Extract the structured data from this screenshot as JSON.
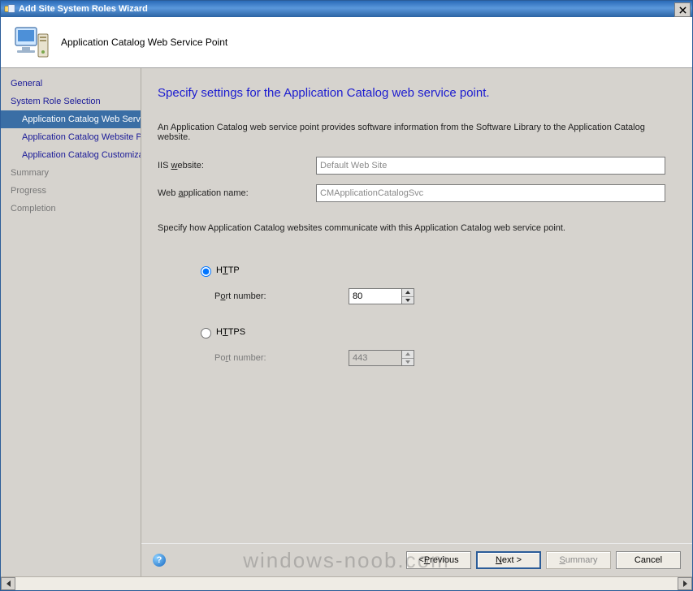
{
  "window": {
    "title": "Add Site System Roles Wizard",
    "close_tooltip": "Close"
  },
  "banner": {
    "title": "Application Catalog Web Service Point"
  },
  "sidebar": {
    "items": [
      {
        "label": "General",
        "indent": false,
        "selected": false,
        "disabled": false
      },
      {
        "label": "System Role Selection",
        "indent": false,
        "selected": false,
        "disabled": false
      },
      {
        "label": "Application Catalog Web Service Point",
        "indent": true,
        "selected": true,
        "disabled": false
      },
      {
        "label": "Application Catalog Website Point",
        "indent": true,
        "selected": false,
        "disabled": false
      },
      {
        "label": "Application Catalog Customizations",
        "indent": true,
        "selected": false,
        "disabled": false
      },
      {
        "label": "Summary",
        "indent": false,
        "selected": false,
        "disabled": true
      },
      {
        "label": "Progress",
        "indent": false,
        "selected": false,
        "disabled": true
      },
      {
        "label": "Completion",
        "indent": false,
        "selected": false,
        "disabled": true
      }
    ]
  },
  "main": {
    "heading": "Specify settings for the Application Catalog web service point.",
    "description": "An Application Catalog web service point provides software information from the Software Library to the Application Catalog website.",
    "iis_label_pre": "IIS ",
    "iis_label_u": "w",
    "iis_label_post": "ebsite:",
    "iis_value": "Default Web Site",
    "webapp_label_pre": "Web ",
    "webapp_label_u": "a",
    "webapp_label_post": "pplication name:",
    "webapp_value": "CMApplicationCatalogSvc",
    "communicate_note": "Specify how Application Catalog websites communicate with this Application Catalog web service point.",
    "http": {
      "label_pre": "H",
      "label_u": "T",
      "label_post": "TP",
      "port_label_pre": "P",
      "port_label_u": "o",
      "port_label_post": "rt number:",
      "port_value": "80",
      "selected": true
    },
    "https": {
      "label_pre": "H",
      "label_u": "T",
      "label_post": "TPS",
      "port_label_pre": "Po",
      "port_label_u": "r",
      "port_label_post": "t number:",
      "port_value": "443",
      "selected": false
    }
  },
  "buttons": {
    "previous_pre": "< ",
    "previous_u": "P",
    "previous_post": "revious",
    "next_u": "N",
    "next_post": "ext >",
    "summary_u": "S",
    "summary_post": "ummary",
    "cancel": "Cancel"
  },
  "watermark": "windows-noob.com"
}
